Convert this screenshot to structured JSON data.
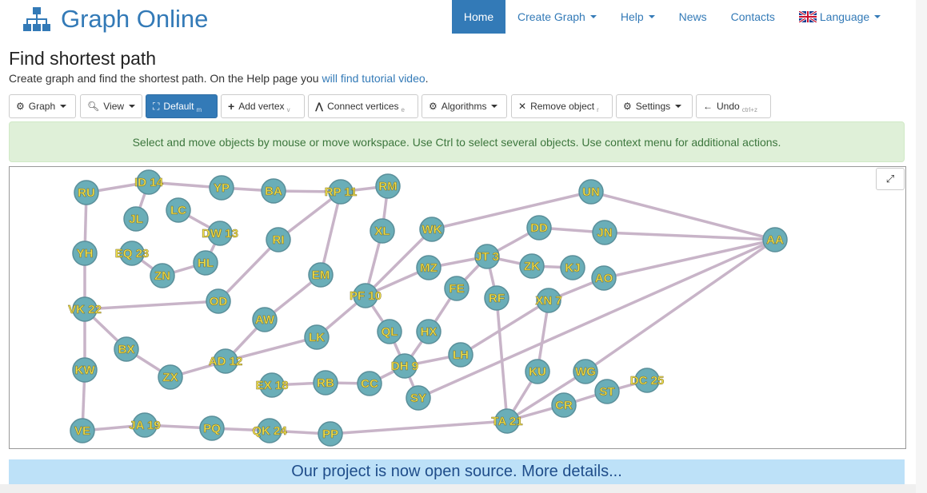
{
  "brand": {
    "title": "Graph Online",
    "icon": "sitemap-icon"
  },
  "nav": {
    "items": [
      {
        "label": "Home",
        "active": true,
        "caret": false
      },
      {
        "label": "Create Graph",
        "active": false,
        "caret": true
      },
      {
        "label": "Help",
        "active": false,
        "caret": true
      },
      {
        "label": "News",
        "active": false,
        "caret": false
      },
      {
        "label": "Contacts",
        "active": false,
        "caret": false
      },
      {
        "label": "Language",
        "active": false,
        "caret": true,
        "icon": "uk-flag-icon"
      }
    ]
  },
  "heading": {
    "title": "Find shortest path",
    "subtitle_prefix": "Create graph and find the shortest path. On the Help page you ",
    "subtitle_link": "will find tutorial video",
    "subtitle_suffix": "."
  },
  "toolbar": {
    "buttons": [
      {
        "label": "Graph",
        "icon": "gear-icon",
        "hint": "",
        "caret": true,
        "primary": false
      },
      {
        "label": "View",
        "icon": "zoom-icon",
        "hint": "",
        "caret": true,
        "primary": false
      },
      {
        "label": "Default",
        "icon": "fit-icon",
        "hint": "m",
        "caret": false,
        "primary": true
      },
      {
        "label": "Add vertex",
        "icon": "plus-icon",
        "hint": "v",
        "caret": false,
        "primary": false
      },
      {
        "label": "Connect vertices",
        "icon": "connect-icon",
        "hint": "e",
        "caret": false,
        "primary": false
      },
      {
        "label": "Algorithms",
        "icon": "gear-icon",
        "hint": "",
        "caret": true,
        "primary": false
      },
      {
        "label": "Remove object",
        "icon": "close-icon",
        "hint": "r",
        "caret": false,
        "primary": false
      },
      {
        "label": "Settings",
        "icon": "gear-icon",
        "hint": "",
        "caret": true,
        "primary": false
      },
      {
        "label": "Undo",
        "icon": "arrow-left-icon",
        "hint": "ctrl+z",
        "caret": false,
        "primary": false
      }
    ]
  },
  "alert": {
    "text": "Select and move objects by mouse or move workspace. Use Ctrl to select several objects. Use context menu for additional actions."
  },
  "banner": {
    "text": "Our project is now open source. More details..."
  },
  "graph": {
    "vertex_fill": "#6aaeb8",
    "vertex_stroke": "#5a8f9a",
    "edge_color": "#c8b4c8",
    "label_color": "#f0e04b",
    "vertices": [
      "RU",
      "ID 14",
      "YP",
      "BA",
      "RP 11",
      "RM",
      "UN",
      "JL",
      "LC",
      "DW 13",
      "RI",
      "XL",
      "WK",
      "DD",
      "JN",
      "AA",
      "YH",
      "EQ 23",
      "HL",
      "ZN",
      "MZ",
      "JT 3",
      "ZK",
      "KJ",
      "EM",
      "AO",
      "FE",
      "PF 10",
      "RF",
      "XN 7",
      "OD",
      "VK 22",
      "AW",
      "BX",
      "LK",
      "QL",
      "HX",
      "AD 12",
      "LH",
      "DH 9",
      "KW",
      "ZX",
      "EX 18",
      "RB",
      "CC",
      "KU",
      "WG",
      "DC 25",
      "ST",
      "SY",
      "CR",
      "VE",
      "JA 19",
      "PQ",
      "QK 24",
      "PP",
      "TA 21"
    ],
    "edges": [
      [
        "RU",
        "ID 14"
      ],
      [
        "ID 14",
        "YP"
      ],
      [
        "YP",
        "BA"
      ],
      [
        "BA",
        "RP 11"
      ],
      [
        "RP 11",
        "RM"
      ],
      [
        "RU",
        "YH"
      ],
      [
        "YH",
        "VK 22"
      ],
      [
        "VK 22",
        "KW"
      ],
      [
        "KW",
        "VE"
      ],
      [
        "VK 22",
        "BX"
      ],
      [
        "BX",
        "ZX"
      ],
      [
        "ZX",
        "AD 12"
      ],
      [
        "ID 14",
        "JL"
      ],
      [
        "LC",
        "DW 13"
      ],
      [
        "DW 13",
        "HL"
      ],
      [
        "HL",
        "ZN"
      ],
      [
        "ZN",
        "EQ 23"
      ],
      [
        "VK 22",
        "OD"
      ],
      [
        "OD",
        "RI"
      ],
      [
        "RI",
        "RP 11"
      ],
      [
        "RP 11",
        "EM"
      ],
      [
        "EM",
        "AW"
      ],
      [
        "AW",
        "AD 12"
      ],
      [
        "AD 12",
        "LK"
      ],
      [
        "LK",
        "PF 10"
      ],
      [
        "RM",
        "XL"
      ],
      [
        "XL",
        "PF 10"
      ],
      [
        "WK",
        "PF 10"
      ],
      [
        "WK",
        "UN"
      ],
      [
        "UN",
        "AA"
      ],
      [
        "PF 10",
        "MZ"
      ],
      [
        "MZ",
        "JT 3"
      ],
      [
        "JT 3",
        "DD"
      ],
      [
        "DD",
        "JN"
      ],
      [
        "JN",
        "AA"
      ],
      [
        "JT 3",
        "ZK"
      ],
      [
        "ZK",
        "KJ"
      ],
      [
        "JT 3",
        "FE"
      ],
      [
        "JT 3",
        "RF"
      ],
      [
        "FE",
        "HX"
      ],
      [
        "HX",
        "DH 9"
      ],
      [
        "PF 10",
        "QL"
      ],
      [
        "QL",
        "DH 9"
      ],
      [
        "DH 9",
        "LH"
      ],
      [
        "DH 9",
        "CC"
      ],
      [
        "DH 9",
        "SY"
      ],
      [
        "LH",
        "XN 7"
      ],
      [
        "EX 18",
        "RB"
      ],
      [
        "RB",
        "CC"
      ],
      [
        "SY",
        "AA"
      ],
      [
        "AO",
        "AA"
      ],
      [
        "XN 7",
        "AO"
      ],
      [
        "XN 7",
        "KU"
      ],
      [
        "KU",
        "TA 21"
      ],
      [
        "WG",
        "AA"
      ],
      [
        "WG",
        "TA 21"
      ],
      [
        "RF",
        "TA 21"
      ],
      [
        "TA 21",
        "CR"
      ],
      [
        "CR",
        "ST"
      ],
      [
        "ST",
        "DC 25"
      ],
      [
        "VE",
        "JA 19"
      ],
      [
        "JA 19",
        "PQ"
      ],
      [
        "PQ",
        "QK 24"
      ],
      [
        "QK 24",
        "PP"
      ],
      [
        "PP",
        "TA 21"
      ]
    ]
  }
}
